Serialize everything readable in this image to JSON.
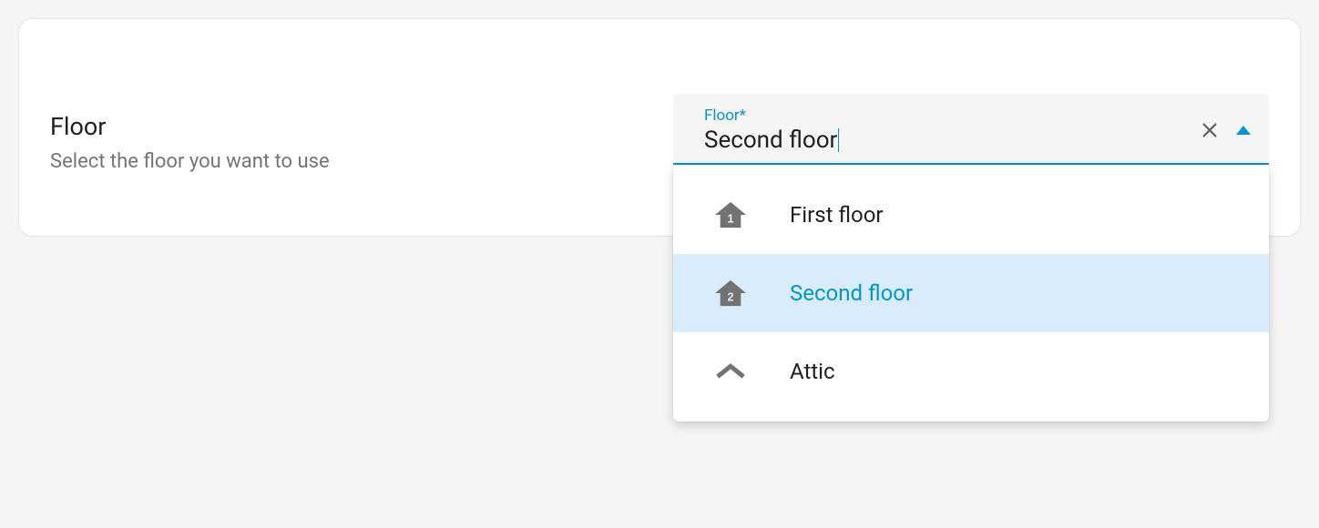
{
  "section": {
    "title": "Floor",
    "subtitle": "Select the floor you want to use"
  },
  "select": {
    "label": "Floor*",
    "value": "Second floor"
  },
  "options": [
    {
      "label": "First floor"
    },
    {
      "label": "Second floor"
    },
    {
      "label": "Attic"
    }
  ]
}
